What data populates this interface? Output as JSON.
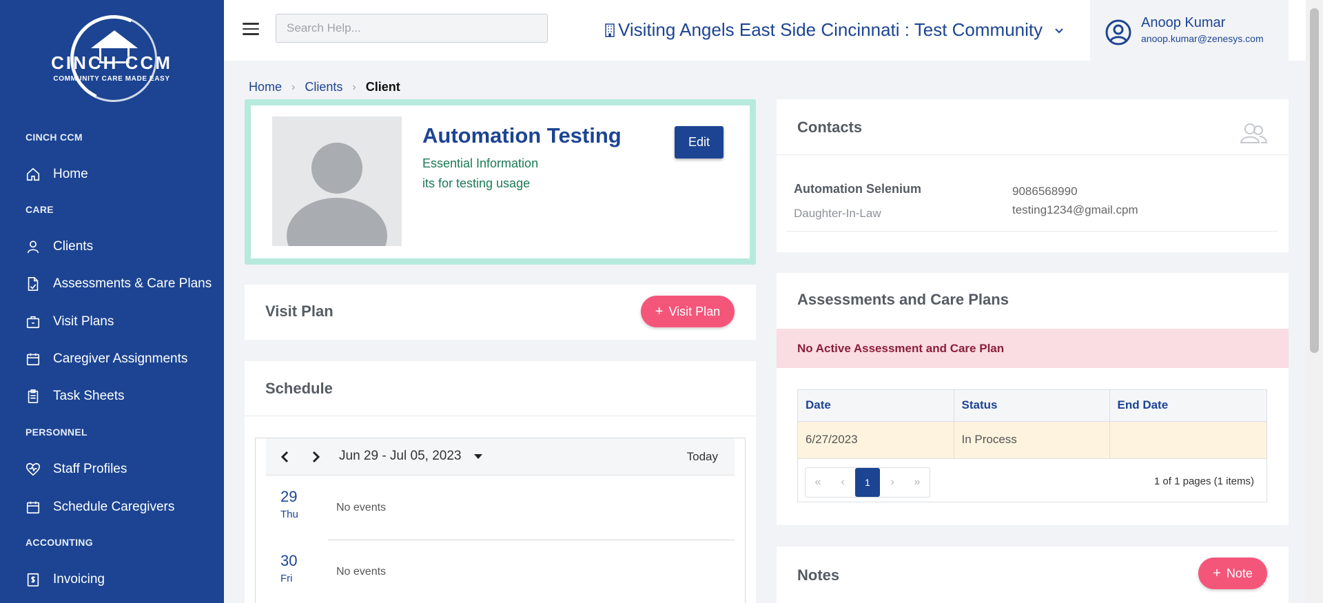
{
  "sidebar": {
    "logo_title": "CINCH CCM",
    "logo_tagline": "COMMUNITY CARE MADE EASY",
    "sections": [
      "CINCH CCM",
      "CARE",
      "PERSONNEL",
      "ACCOUNTING"
    ],
    "items": [
      {
        "label": "Home",
        "icon": "home-icon"
      },
      {
        "label": "Clients",
        "icon": "user-icon"
      },
      {
        "label": "Assessments & Care Plans",
        "icon": "document-icon"
      },
      {
        "label": "Visit Plans",
        "icon": "briefcase-icon"
      },
      {
        "label": "Caregiver Assignments",
        "icon": "calendar-icon"
      },
      {
        "label": "Task Sheets",
        "icon": "clipboard-icon"
      },
      {
        "label": "Staff Profiles",
        "icon": "heart-pulse-icon"
      },
      {
        "label": "Schedule Caregivers",
        "icon": "calendar-icon"
      },
      {
        "label": "Invoicing",
        "icon": "invoice-icon"
      }
    ]
  },
  "topbar": {
    "search_placeholder": "Search Help...",
    "community": "Visiting Angels East Side Cincinnati : Test Community",
    "user_name": "Anoop Kumar",
    "user_email": "anoop.kumar@zenesys.com"
  },
  "breadcrumb": {
    "home": "Home",
    "clients": "Clients",
    "current": "Client"
  },
  "profile": {
    "name": "Automation Testing",
    "info": "Essential Information",
    "note": "its for testing usage",
    "edit_label": "Edit"
  },
  "visit_plan": {
    "title": "Visit Plan",
    "button": "Visit Plan"
  },
  "schedule": {
    "title": "Schedule",
    "range": "Jun 29 - Jul 05, 2023",
    "today_label": "Today",
    "days": [
      {
        "num": "29",
        "dow": "Thu",
        "events": "No events"
      },
      {
        "num": "30",
        "dow": "Fri",
        "events": "No events"
      }
    ]
  },
  "contacts": {
    "title": "Contacts",
    "name": "Automation Selenium",
    "relation": "Daughter-In-Law",
    "phone": "9086568990",
    "email": "testing1234@gmail.cpm"
  },
  "acp": {
    "title": "Assessments and Care Plans",
    "alert": "No Active Assessment and Care Plan",
    "columns": [
      "Date",
      "Status",
      "End Date"
    ],
    "rows": [
      [
        "6/27/2023",
        "In Process",
        ""
      ]
    ],
    "page": "1",
    "page_info": "1 of 1 pages (1 items)"
  },
  "notes": {
    "title": "Notes",
    "button": "Note"
  },
  "colors": {
    "primary": "#1c4492",
    "accent": "#f4567a",
    "alert_bg": "#fadce3",
    "profile_border": "#b6eadc"
  }
}
